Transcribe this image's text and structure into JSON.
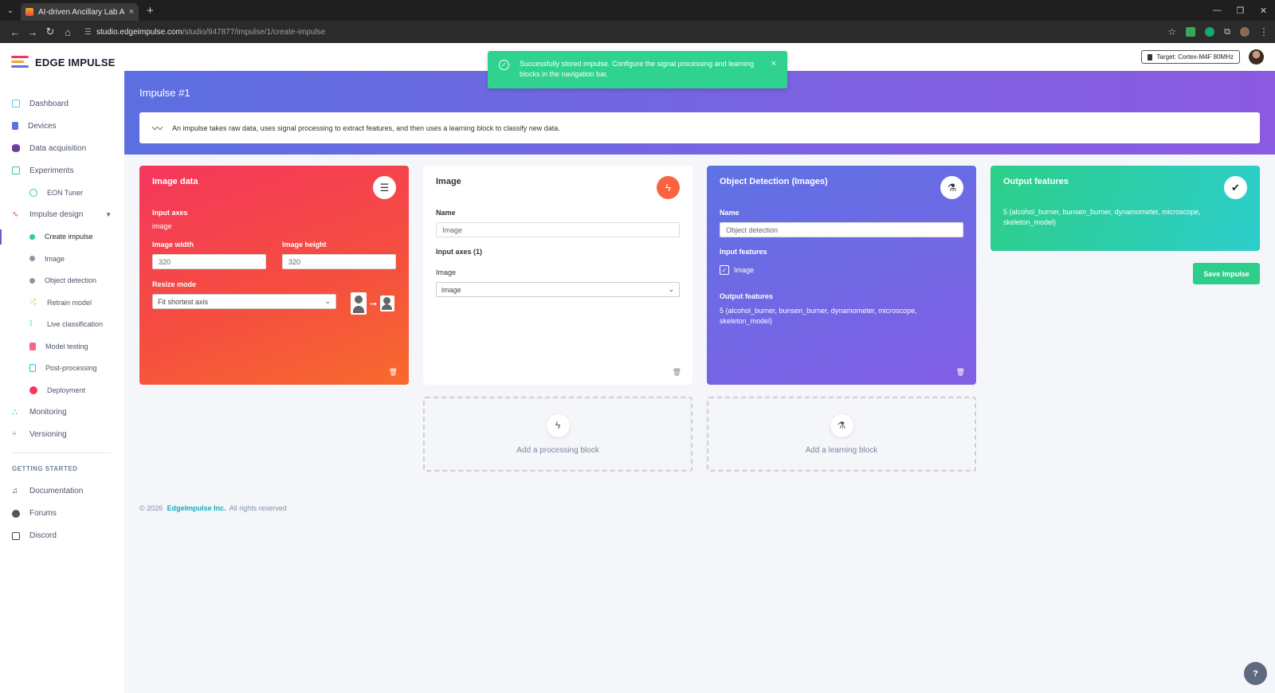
{
  "browser": {
    "tab_title": "AI-driven Ancillary Lab Assistant",
    "tab_close": "×",
    "new_tab": "+",
    "url_host": "studio.edgeimpulse.com",
    "url_path": "/studio/947877/impulse/1/create-impulse"
  },
  "sidebar": {
    "brand": "EDGE IMPULSE",
    "items": [
      {
        "label": "Dashboard",
        "color": "#5ec8e5"
      },
      {
        "label": "Devices",
        "color": "#5e72e4"
      },
      {
        "label": "Data acquisition",
        "color": "#6b3fa0"
      },
      {
        "label": "Experiments",
        "color": "#2dce89"
      },
      {
        "label": "EON Tuner",
        "color": "#2dce89"
      },
      {
        "label": "Impulse design",
        "color": "#f5365c"
      },
      {
        "label": "Create impulse",
        "color": "#2dce89"
      },
      {
        "label": "Image",
        "color": "#8898aa"
      },
      {
        "label": "Object detection",
        "color": "#8898aa"
      },
      {
        "label": "Retrain model",
        "color": "#f5b335"
      },
      {
        "label": "Live classification",
        "color": "#2dce89"
      },
      {
        "label": "Model testing",
        "color": "#f5365c"
      },
      {
        "label": "Post-processing",
        "color": "#11cdef"
      },
      {
        "label": "Deployment",
        "color": "#f5365c"
      },
      {
        "label": "Monitoring",
        "color": "#11cdef"
      },
      {
        "label": "Versioning",
        "color": "#5e72e4"
      }
    ],
    "getting_started_title": "GETTING STARTED",
    "getting_started": [
      {
        "label": "Documentation"
      },
      {
        "label": "Forums"
      },
      {
        "label": "Discord"
      }
    ]
  },
  "topbar": {
    "target": "Target: Cortex-M4F 80MHz"
  },
  "toast": {
    "message": "Successfully stored impulse. Configure the signal processing and learning blocks in the navigation bar.",
    "close": "×"
  },
  "header": {
    "title": "Impulse #1",
    "info": "An impulse takes raw data, uses signal processing to extract features, and then uses a learning block to classify new data."
  },
  "cards": {
    "image_data": {
      "title": "Image data",
      "input_axes_label": "Input axes",
      "input_axes_value": "image",
      "width_label": "Image width",
      "width_value": "320",
      "height_label": "Image height",
      "height_value": "320",
      "resize_label": "Resize mode",
      "resize_value": "Fit shortest axis"
    },
    "processing": {
      "title": "Image",
      "name_label": "Name",
      "name_value": "Image",
      "axes_label": "Input axes (1)",
      "image_label": "Image",
      "image_select": "image"
    },
    "learning": {
      "title": "Object Detection (Images)",
      "name_label": "Name",
      "name_value": "Object detection",
      "input_features_label": "Input features",
      "input_feature": "Image",
      "output_features_label": "Output features",
      "output_features": "5 (alcohol_burner, bunsen_burner, dynamometer, microscope, skeleton_model)"
    },
    "output": {
      "title": "Output features",
      "value": "5 (alcohol_burner, bunsen_burner, dynamometer, microscope, skeleton_model)"
    }
  },
  "save_button": "Save Impulse",
  "add_processing": "Add a processing block",
  "add_learning": "Add a learning block",
  "footer": {
    "copyright": "© 2026",
    "company": "EdgeImpulse Inc.",
    "rights": "All rights reserved"
  },
  "help": "?"
}
